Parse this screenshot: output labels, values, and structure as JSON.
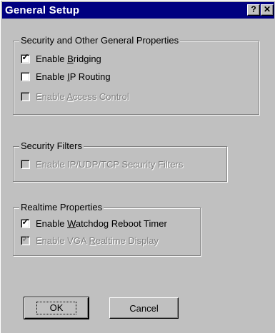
{
  "dialog": {
    "title": "General Setup",
    "help_glyph": "?",
    "close_glyph": "✕"
  },
  "security_group": {
    "legend": "Security and Other General Properties",
    "enable_bridging": {
      "pre": "Enable ",
      "accel": "B",
      "post": "ridging",
      "checked": true,
      "enabled": true
    },
    "enable_ip_routing": {
      "pre": "Enable ",
      "accel": "I",
      "post": "P Routing",
      "checked": false,
      "enabled": true
    },
    "enable_access_control": {
      "pre": "Enable ",
      "accel": "A",
      "post": "ccess Control",
      "checked": false,
      "enabled": false
    }
  },
  "filters_group": {
    "legend": "Security Filters",
    "enable_security_filters": {
      "label": "Enable IP/UDP/TCP Security Filters",
      "checked": false,
      "enabled": false
    }
  },
  "realtime_group": {
    "legend": "Realtime Properties",
    "enable_watchdog": {
      "pre": "Enable ",
      "accel": "W",
      "post": "atchdog Reboot Timer",
      "checked": true,
      "enabled": true
    },
    "enable_vga_realtime": {
      "pre": "Enable VGA ",
      "accel": "R",
      "post": "ealtime Display",
      "checked": true,
      "enabled": false
    }
  },
  "buttons": {
    "ok": "OK",
    "cancel": "Cancel"
  },
  "checkmark_glyph": "✓"
}
